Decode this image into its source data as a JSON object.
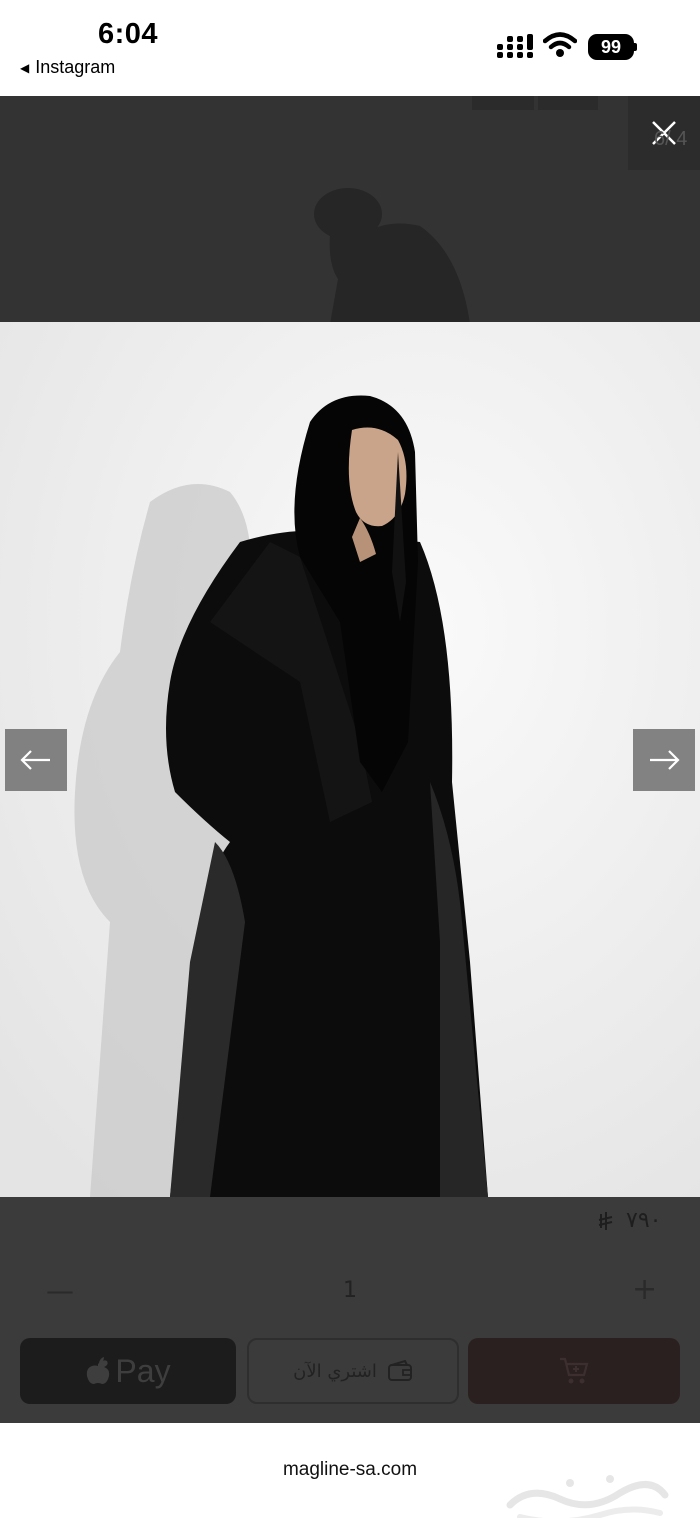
{
  "status_bar": {
    "time": "6:04",
    "back_app": "Instagram",
    "battery": "99"
  },
  "gallery": {
    "counter": "6/ 4",
    "prev_icon": "arrow-left-icon",
    "next_icon": "arrow-right-icon",
    "close_icon": "close-icon"
  },
  "product": {
    "price": "٧٩٠",
    "currency_symbol": "riyal-icon",
    "quantity": "1",
    "minus_label": "—",
    "plus_label": "+"
  },
  "actions": {
    "apple_pay_label": "Pay",
    "buy_now_label": "اشتري الآن",
    "cart_icon": "cart-icon"
  },
  "browser": {
    "url": "magline-sa.com"
  },
  "colors": {
    "overlay": "#3b3b3b",
    "photo_bg": "#f2f2f2",
    "cart_button": "#2a2020"
  }
}
